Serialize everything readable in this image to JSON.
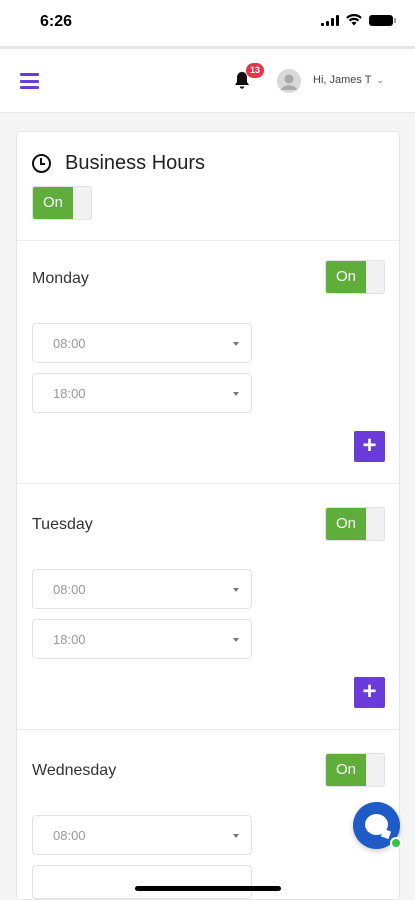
{
  "status_bar": {
    "time": "6:26"
  },
  "header": {
    "notification_count": "13",
    "user_greeting": "Hi, James T",
    "accent_color": "#6a3bd8"
  },
  "business_hours": {
    "title": "Business Hours",
    "toggle_label": "On",
    "days": [
      {
        "name": "Monday",
        "toggle_label": "On",
        "start_time": "08:00",
        "end_time": "18:00"
      },
      {
        "name": "Tuesday",
        "toggle_label": "On",
        "start_time": "08:00",
        "end_time": "18:00"
      },
      {
        "name": "Wednesday",
        "toggle_label": "On",
        "start_time": "08:00",
        "end_time": ""
      }
    ],
    "add_label": "+"
  },
  "colors": {
    "toggle_on": "#5fae3b",
    "add_button": "#6a3bd8",
    "chat_fab": "#1e5bc6",
    "badge": "#e5344b"
  },
  "icons": [
    "menu-icon",
    "bell-icon",
    "avatar-icon",
    "clock-icon",
    "chevron-down-icon",
    "plus-icon",
    "chat-icon"
  ]
}
